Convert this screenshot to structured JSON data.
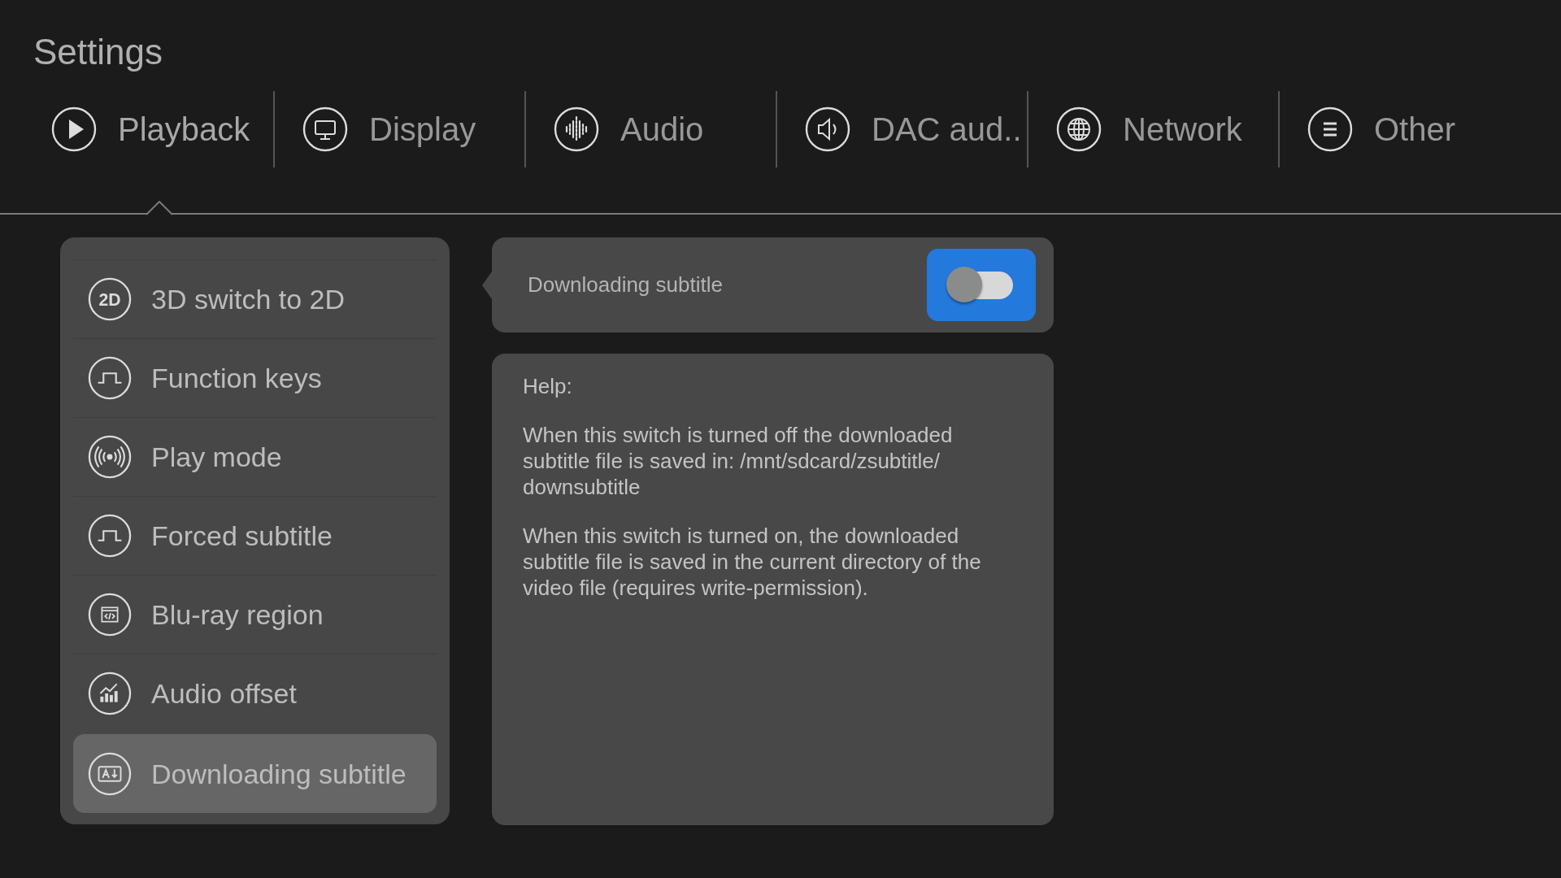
{
  "title": "Settings",
  "tabs": [
    {
      "label": "Playback",
      "kind": "play",
      "selected": true
    },
    {
      "label": "Display",
      "kind": "monitor",
      "selected": false
    },
    {
      "label": "Audio",
      "kind": "wave",
      "selected": false
    },
    {
      "label": "DAC aud..",
      "kind": "speaker",
      "selected": false
    },
    {
      "label": "Network",
      "kind": "globe",
      "selected": false
    },
    {
      "label": "Other",
      "kind": "list",
      "selected": false
    }
  ],
  "menu": [
    {
      "label": "3D switch to 2D",
      "kind": "badge",
      "badge": "2D",
      "selected": false
    },
    {
      "label": "Function keys",
      "kind": "pulse",
      "selected": false
    },
    {
      "label": "Play mode",
      "kind": "broadcast",
      "selected": false
    },
    {
      "label": "Forced subtitle",
      "kind": "pulse",
      "selected": false
    },
    {
      "label": "Blu-ray region",
      "kind": "code",
      "selected": false
    },
    {
      "label": "Audio offset",
      "kind": "chart",
      "selected": false
    },
    {
      "label": "Downloading subtitle",
      "kind": "download",
      "selected": true
    }
  ],
  "setting": {
    "label": "Downloading subtitle",
    "on": false
  },
  "help": {
    "heading": "Help:",
    "paragraphs": [
      "When this switch is turned off the downloaded subtitle file is saved in: /mnt/sdcard/zsubtitle/ downsubtitle",
      "When this switch is turned on, the downloaded subtitle file is saved in the current directory of the video file (requires write-permission)."
    ]
  }
}
